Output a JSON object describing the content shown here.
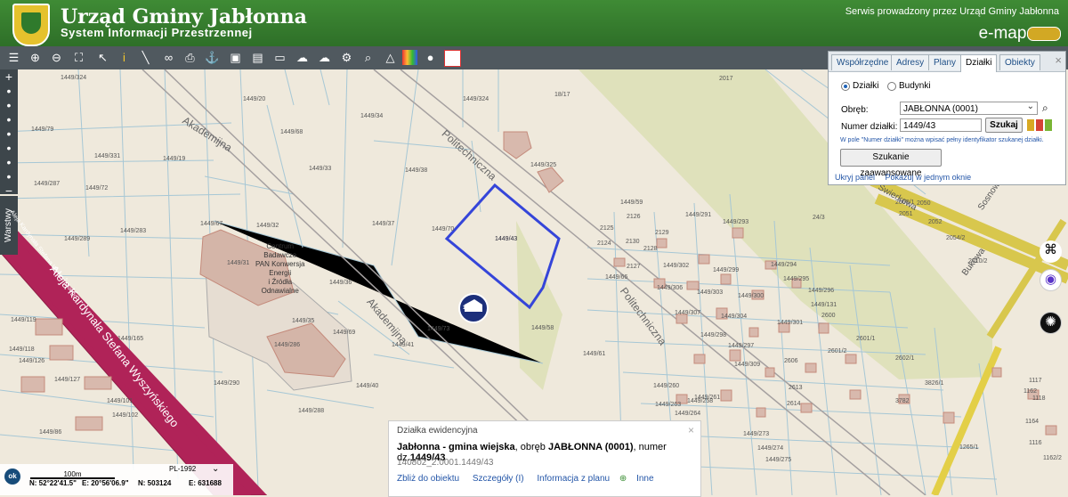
{
  "header": {
    "title": "Urząd Gminy Jabłonna",
    "subtitle": "System Informacji Przestrzennej",
    "service": "Serwis prowadzony przez Urząd Gminy Jabłonna",
    "brand": "e-mapa"
  },
  "toolbar": {
    "tools": [
      "layers-icon",
      "zoom-in-icon",
      "zoom-out-icon",
      "zoom-extent-icon",
      "select-icon",
      "info-icon",
      "measure-icon",
      "link-icon",
      "print-icon",
      "anchor-icon",
      "copy-icon",
      "layout-icon",
      "comment-icon",
      "cloud-icon",
      "settings-icon",
      "search-map-icon",
      "triangle-icon",
      "palette-icon",
      "marker-icon",
      "red-square-icon"
    ]
  },
  "sidebar": {
    "label": "Warstwy"
  },
  "panel": {
    "tabs": [
      "Współrzędne",
      "Adresy",
      "Plany",
      "Działki",
      "Obiekty"
    ],
    "active_tab": "Działki",
    "radio_dzialki": "Działki",
    "radio_budynki": "Budynki",
    "obreb_label": "Obręb:",
    "obreb_value": "JABŁONNA (0001)",
    "numer_label": "Numer działki:",
    "numer_value": "1449/43",
    "search_button": "Szukaj",
    "hint": "W pole \"Numer działki\" można wpisać pełny identyfikator szukanej działki.",
    "advanced_button": "Szukanie zaawansowane",
    "hide_panel": "Ukryj panel",
    "show_one_window": "Pokazuj w jednym oknie"
  },
  "map": {
    "roads": [
      {
        "name": "Akademijna",
        "pos": "upper"
      },
      {
        "name": "Akademijna",
        "pos": "lower"
      },
      {
        "name": "Politechniczna",
        "pos": "upper"
      },
      {
        "name": "Politechniczna",
        "pos": "lower"
      },
      {
        "name": "Aleja Kardynała Stefana Wyszyńskiego",
        "pos": "lower"
      },
      {
        "name": "Aleja Kardynała Stefana Wyszyńskiego",
        "pos": "upper"
      },
      {
        "name": "Bukowa",
        "pos": "right"
      },
      {
        "name": "Sosnowa",
        "pos": "right"
      },
      {
        "name": "Świerkowa",
        "pos": "right"
      }
    ],
    "poi": [
      "Centrum",
      "Badawcze",
      "PAN Konwersja",
      "Energii",
      "i Źródła",
      "Odnawialne"
    ],
    "selected_parcel": "1449/43",
    "marker_label": "1449/43",
    "parcels": [
      "1449/324",
      "1449/34",
      "1449/20",
      "1449/68",
      "1449/79",
      "1449/331",
      "1449/19",
      "1449/33",
      "1449/38",
      "1449/287",
      "1449/72",
      "1449/37",
      "1449/283",
      "1449/32",
      "1449/67",
      "1449/289",
      "1449/31",
      "1449/36",
      "1449/35",
      "1449/69",
      "1449/73",
      "1449/41",
      "1449/58",
      "1449/61",
      "1449/40",
      "1449/290",
      "1449/288",
      "1449/286",
      "1449/165",
      "1449/119",
      "1449/118",
      "1449/126",
      "1449/127",
      "1449/101",
      "1449/102",
      "1449/86",
      "1449/70",
      "1449/66",
      "1449/59",
      "1449/291",
      "1449/293",
      "1449/294",
      "1449/295",
      "1449/296",
      "1449/131",
      "1449/299",
      "1449/303",
      "1449/300",
      "1449/302",
      "1449/306",
      "1449/307",
      "1449/304",
      "1449/301",
      "1449/297",
      "1449/298",
      "1449/309",
      "1449/260",
      "1449/261",
      "1449/264",
      "1449/258",
      "1449/263",
      "1449/273",
      "1449/274",
      "1449/275",
      "1449/325",
      "18/17",
      "24/3",
      "2126",
      "2125",
      "2130",
      "2128",
      "2129",
      "2124",
      "2127",
      "2600",
      "2601/1",
      "2601/2",
      "2602/1",
      "2606",
      "2613",
      "2614",
      "3782",
      "3826/1",
      "2060/1",
      "2050",
      "2051",
      "2052",
      "2054/2",
      "2010/2",
      "2017",
      "1162",
      "1164",
      "1265/1",
      "1117",
      "1118",
      "1116",
      "1162/2",
      "1161"
    ],
    "popup": {
      "header": "Działka ewidencyjna",
      "location_bold": "Jabłonna - gmina wiejska",
      "obreb_prefix": ", obręb ",
      "obreb_bold": "JABŁONNA (0001)",
      "number_prefix": ", numer dz.",
      "number_bold": "1449/43",
      "identifier": "140802_2.0001.1449/43",
      "links": [
        "Zbliż do obiektu",
        "Szczegóły (I)",
        "Informacja z planu",
        "Inne"
      ]
    }
  },
  "status": {
    "scale_label": "100m",
    "crs": "PL-1992",
    "ok": "ok",
    "north": "N: 52°22'41.5\"",
    "east": "E: 20°56'06.9\"",
    "n": "N: 503124",
    "e": "E: 631688"
  },
  "colors": {
    "header": "#3f8b35",
    "selected": "#3545d9",
    "alley": "#b02358",
    "road": "#fff4a7",
    "park": "#dfe1bb"
  }
}
